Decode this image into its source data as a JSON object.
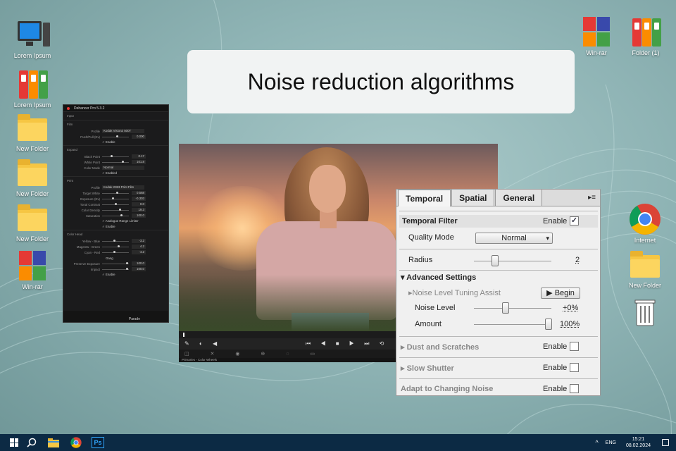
{
  "headline": "Noise reduction algorithms",
  "desktop": {
    "left_icons": [
      "Lorem Ipsum",
      "Lorem Ipsum",
      "New Folder",
      "New Folder",
      "New Folder",
      "Win-rar"
    ],
    "top_right_icons": [
      "Win-rar",
      "Folder (1)"
    ],
    "right_icons": [
      "Internet",
      "New Folder"
    ]
  },
  "dehancer": {
    "title": "Dehancer Pro 5.3.2",
    "sections": {
      "input": "Input",
      "film": "Film",
      "expand": "Expand",
      "print": "Print",
      "color_head": "Color Head"
    },
    "film_rows": [
      {
        "label": "Profile",
        "value": "Kodak Vision3 500T"
      },
      {
        "label": "Push/Pull (Ev)",
        "value": "0.000"
      }
    ],
    "film_enable": "Enable",
    "expand_rows": [
      {
        "label": "Black Point",
        "value": "0.17"
      },
      {
        "label": "White Point",
        "value": "101.8"
      },
      {
        "label": "Color Mode",
        "value": "Normal"
      }
    ],
    "expand_enable": "Enabled",
    "print_rows": [
      {
        "label": "Profile",
        "value": "Kodak 2383 Print Film"
      },
      {
        "label": "Target White",
        "value": "0.568"
      },
      {
        "label": "Exposure (Ev)",
        "value": "-0.303"
      },
      {
        "label": "Tonal Contrast",
        "value": "0.0"
      },
      {
        "label": "Color Density",
        "value": "19.3"
      },
      {
        "label": "Saturation",
        "value": "100.0"
      }
    ],
    "print_checks": [
      "Analogue Range Limiter",
      "Enable"
    ],
    "head_rows": [
      {
        "label": "Yellow - Blue",
        "value": "-3.2"
      },
      {
        "label": "Magenta - Green",
        "value": "4.2"
      },
      {
        "label": "Cyan - Red",
        "value": "-4.2"
      }
    ],
    "gang": "Gang",
    "head_rows2": [
      {
        "label": "Preserve Exposure",
        "value": "100.0"
      },
      {
        "label": "Impact",
        "value": "100.0"
      }
    ],
    "head_enable": "Enable",
    "bottom_label": "Parade"
  },
  "viewer": {
    "status_left": "Primaries - Color Wheels",
    "status_right": "Curves"
  },
  "noise_panel": {
    "tabs": [
      "Temporal",
      "Spatial",
      "General"
    ],
    "active_tab": "Temporal",
    "temporal_filter": {
      "label": "Temporal Filter",
      "enable": "Enable",
      "checked": "✓"
    },
    "quality_mode": {
      "label": "Quality Mode",
      "value": "Normal"
    },
    "radius": {
      "label": "Radius",
      "value": "2"
    },
    "advanced": "Advanced Settings",
    "tuning": {
      "label": "Noise Level Tuning Assist",
      "button": "Begin"
    },
    "noise_level": {
      "label": "Noise Level",
      "value": "+0%"
    },
    "amount": {
      "label": "Amount",
      "value": "100%"
    },
    "dust": {
      "label": "Dust and Scratches",
      "enable": "Enable"
    },
    "slow": {
      "label": "Slow Shutter",
      "enable": "Enable"
    },
    "adapt": {
      "label": "Adapt to Changing Noise",
      "enable": "Enable"
    }
  },
  "taskbar": {
    "lang": "ENG",
    "time": "15:21",
    "date": "08.02.2024",
    "ps_label": "Ps"
  }
}
